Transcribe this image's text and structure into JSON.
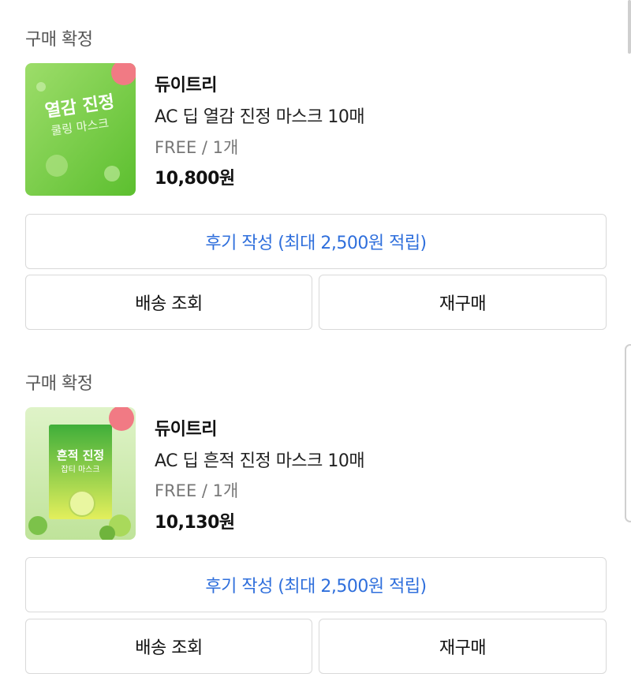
{
  "orders": [
    {
      "status": "구매 확정",
      "brand": "듀이트리",
      "product_name": "AC 딥 열감 진정 마스크 10매",
      "option": "FREE / 1개",
      "price": "10,800원",
      "thumbnail_icon": "cooling-mask-product-image",
      "thumb_text": [
        "열감 진정",
        "쿨링 마스크"
      ],
      "review_button": "후기 작성 (최대 2,500원 적립)",
      "shipping_button": "배송 조회",
      "rebuy_button": "재구매"
    },
    {
      "status": "구매 확정",
      "brand": "듀이트리",
      "product_name": "AC 딥 흔적 진정 마스크 10매",
      "option": "FREE / 1개",
      "price": "10,130원",
      "thumbnail_icon": "trace-mask-product-image",
      "thumb_text": [
        "흔적 진정",
        "잡티 마스크"
      ],
      "review_button": "후기 작성 (최대 2,500원 적립)",
      "shipping_button": "배송 조회",
      "rebuy_button": "재구매"
    }
  ],
  "colors": {
    "review_text": "#2f6fdc",
    "border": "#d9d9d9",
    "status_text": "#555555",
    "option_text": "#777777"
  }
}
